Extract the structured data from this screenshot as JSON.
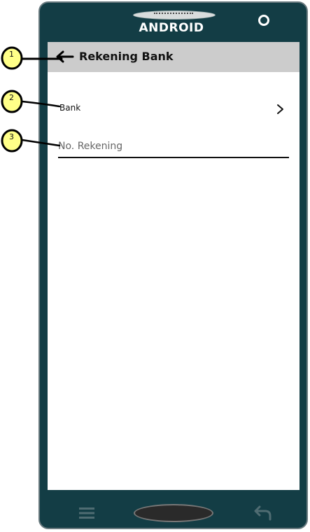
{
  "device": {
    "brand_label": "ANDROID"
  },
  "appbar": {
    "title": "Rekening Bank"
  },
  "form": {
    "bank_label": "Bank",
    "account_placeholder": "No. Rekening"
  },
  "annotations": [
    {
      "number": "1"
    },
    {
      "number": "2"
    },
    {
      "number": "3"
    }
  ],
  "colors": {
    "phone_body": "#133d45",
    "appbar_bg": "#cccccc",
    "callout_fill": "#ffff88"
  }
}
